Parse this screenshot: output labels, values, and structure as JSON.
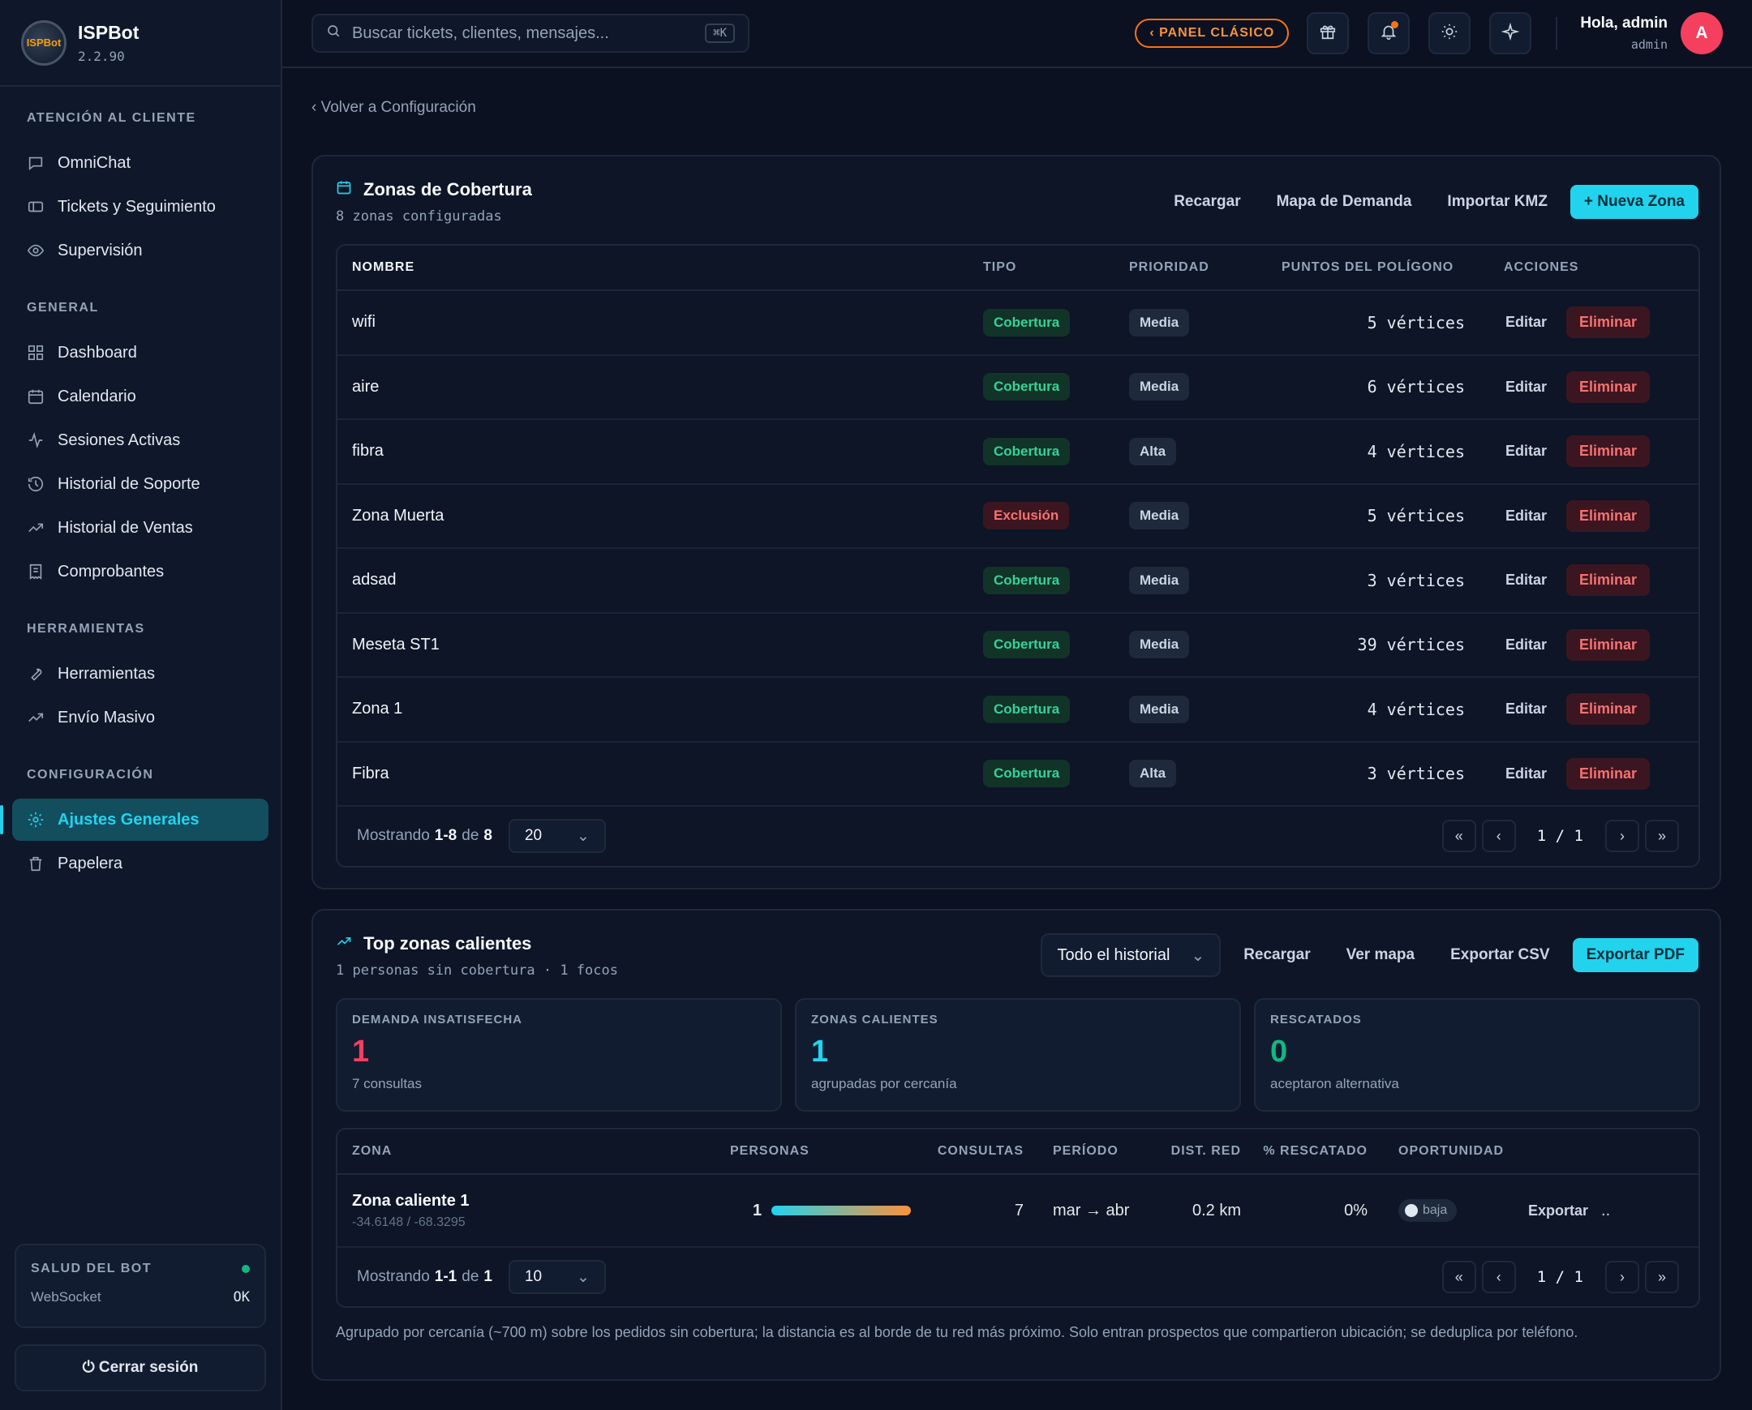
{
  "brand": {
    "name": "ISPBot",
    "version": "2.2.90",
    "logo_text": "ISPBot"
  },
  "sidebar": {
    "sections": [
      {
        "title": "ATENCIÓN AL CLIENTE",
        "items": [
          {
            "label": "OmniChat",
            "icon": "chat-icon"
          },
          {
            "label": "Tickets y Seguimiento",
            "icon": "ticket-icon"
          },
          {
            "label": "Supervisión",
            "icon": "eye-icon"
          }
        ]
      },
      {
        "title": "GENERAL",
        "items": [
          {
            "label": "Dashboard",
            "icon": "grid-icon"
          },
          {
            "label": "Calendario",
            "icon": "calendar-icon"
          },
          {
            "label": "Sesiones Activas",
            "icon": "activity-icon"
          },
          {
            "label": "Historial de Soporte",
            "icon": "history-icon"
          },
          {
            "label": "Historial de Ventas",
            "icon": "trending-icon"
          },
          {
            "label": "Comprobantes",
            "icon": "receipt-icon"
          }
        ]
      },
      {
        "title": "HERRAMIENTAS",
        "items": [
          {
            "label": "Herramientas",
            "icon": "wrench-icon"
          },
          {
            "label": "Envío Masivo",
            "icon": "trending-icon"
          }
        ]
      },
      {
        "title": "CONFIGURACIÓN",
        "items": [
          {
            "label": "Ajustes Generales",
            "icon": "gear-icon",
            "active": true
          },
          {
            "label": "Papelera",
            "icon": "trash-icon"
          }
        ]
      }
    ],
    "health": {
      "title": "SALUD DEL BOT",
      "status_color": "#10b981",
      "row_label": "WebSocket",
      "row_value": "OK"
    },
    "logout_label": "⏻ Cerrar sesión"
  },
  "topbar": {
    "search_placeholder": "Buscar tickets, clientes, mensajes...",
    "search_shortcut": "⌘K",
    "classic_label": "‹ PANEL CLÁSICO",
    "greeting": "Hola, admin",
    "role": "admin",
    "avatar_letter": "A"
  },
  "back_link": "‹ Volver a Configuración",
  "zones": {
    "title": "Zonas de Cobertura",
    "subtitle": "8 zonas configuradas",
    "actions": [
      "Recargar",
      "Mapa de Demanda",
      "Importar KMZ"
    ],
    "new_label": "+ Nueva Zona",
    "headers": {
      "name": "NOMBRE",
      "type": "TIPO",
      "priority": "PRIORIDAD",
      "points": "PUNTOS DEL POLÍGONO",
      "actions": "ACCIONES"
    },
    "edit_label": "Editar",
    "delete_label": "Eliminar",
    "rows": [
      {
        "name": "wifi",
        "type": "Cobertura",
        "priority": "Media",
        "points": "5 vértices"
      },
      {
        "name": "aire",
        "type": "Cobertura",
        "priority": "Media",
        "points": "6 vértices"
      },
      {
        "name": "fibra",
        "type": "Cobertura",
        "priority": "Alta",
        "points": "4 vértices"
      },
      {
        "name": "Zona Muerta",
        "type": "Exclusión",
        "priority": "Media",
        "points": "5 vértices"
      },
      {
        "name": "adsad",
        "type": "Cobertura",
        "priority": "Media",
        "points": "3 vértices"
      },
      {
        "name": "Meseta ST1",
        "type": "Cobertura",
        "priority": "Media",
        "points": "39 vértices"
      },
      {
        "name": "Zona 1",
        "type": "Cobertura",
        "priority": "Media",
        "points": "4 vértices"
      },
      {
        "name": "Fibra",
        "type": "Cobertura",
        "priority": "Alta",
        "points": "3 vértices"
      }
    ],
    "footer": {
      "prefix": "Mostrando",
      "range": "1-8",
      "of": "de",
      "total": "8",
      "page_size": "20",
      "page": "1 / 1"
    }
  },
  "hot": {
    "title": "Top zonas calientes",
    "subtitle": "1 personas sin cobertura · 1 focos",
    "period_select": "Todo el historial",
    "actions": [
      "Recargar",
      "Ver mapa",
      "Exportar CSV"
    ],
    "export_pdf": "Exportar PDF",
    "stats": [
      {
        "label": "DEMANDA INSATISFECHA",
        "value": "1",
        "sub": "7 consultas",
        "color": "#f43f5e"
      },
      {
        "label": "ZONAS CALIENTES",
        "value": "1",
        "sub": "agrupadas por cercanía",
        "color": "#22d3ee"
      },
      {
        "label": "RESCATADOS",
        "value": "0",
        "sub": "aceptaron alternativa",
        "color": "#10b981"
      }
    ],
    "headers": {
      "zone": "ZONA",
      "people": "PERSONAS",
      "queries": "CONSULTAS",
      "period": "PERÍODO",
      "dist": "DIST. RED",
      "rescued": "% RESCATADO",
      "opportunity": "OPORTUNIDAD"
    },
    "rows": [
      {
        "name": "Zona caliente 1",
        "coords": "-34.6148 / -68.3295",
        "people": "1",
        "people_fill": 1.0,
        "queries": "7",
        "period": "mar → abr",
        "dist": "0.2 km",
        "rescued": "0%",
        "opportunity": "baja",
        "export": "Exportar",
        "more": ".."
      }
    ],
    "footer": {
      "prefix": "Mostrando",
      "range": "1-1",
      "of": "de",
      "total": "1",
      "page_size": "10",
      "page": "1 / 1"
    },
    "note": "Agrupado por cercanía (~700 m) sobre los pedidos sin cobertura; la distancia es al borde de tu red más próximo. Solo entran prospectos que compartieron ubicación; se deduplica por teléfono."
  }
}
